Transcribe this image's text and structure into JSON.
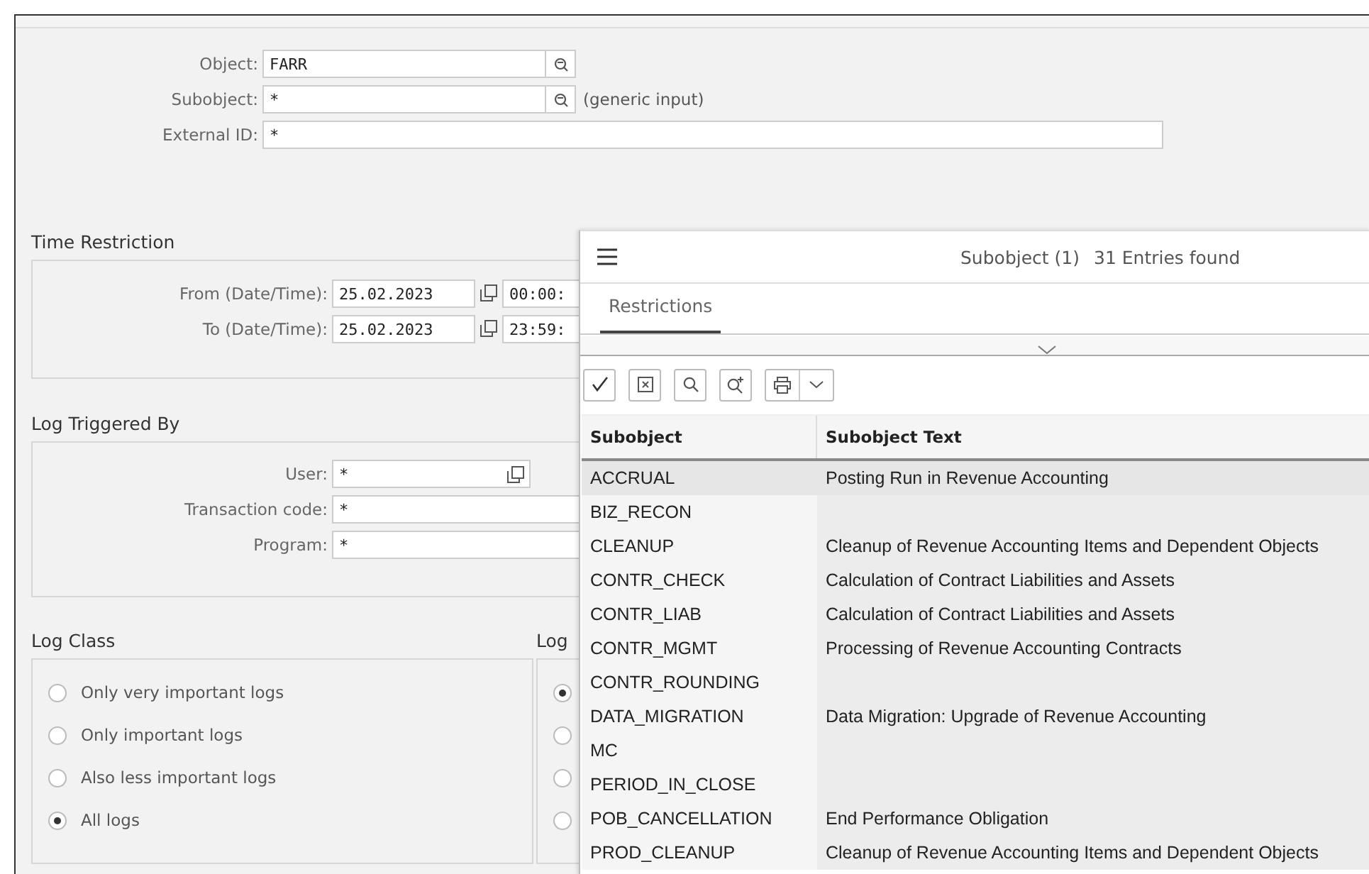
{
  "selection": {
    "fields": [
      {
        "label": "Object:",
        "value": "FARR",
        "has_search": true
      },
      {
        "label": "Subobject:",
        "value": "*",
        "has_search": true,
        "note": "(generic input)"
      },
      {
        "label": "External ID:",
        "value": "*",
        "has_search": false
      }
    ]
  },
  "time_restriction": {
    "title": "Time Restriction",
    "rows": [
      {
        "label": "From (Date/Time):",
        "date": "25.02.2023",
        "time": "00:00:"
      },
      {
        "label": "To (Date/Time):",
        "date": "25.02.2023",
        "time": "23:59:"
      }
    ]
  },
  "log_triggered_by": {
    "title": "Log Triggered By",
    "fields": [
      {
        "label": "User:",
        "value": "*",
        "kind": "short"
      },
      {
        "label": "Transaction code:",
        "value": "*",
        "kind": "long"
      },
      {
        "label": "Program:",
        "value": "*",
        "kind": "long"
      }
    ]
  },
  "log_class": {
    "title": "Log Class",
    "options": [
      {
        "label": "Only very important logs",
        "selected": false
      },
      {
        "label": "Only important logs",
        "selected": false
      },
      {
        "label": "Also less important logs",
        "selected": false
      },
      {
        "label": "All logs",
        "selected": true
      }
    ]
  },
  "group_2": {
    "title": "Log",
    "options": [
      {
        "selected": true
      },
      {
        "selected": false
      },
      {
        "selected": false
      },
      {
        "selected": false
      }
    ]
  },
  "popup": {
    "title": "Subobject (1)",
    "count": "31 Entries found",
    "tabs": [
      {
        "label": "Restrictions",
        "selected": true
      }
    ],
    "columns": [
      "Subobject",
      "Subobject Text"
    ],
    "rows": [
      {
        "code": "ACCRUAL",
        "text": "Posting Run in Revenue Accounting",
        "selected": true
      },
      {
        "code": "BIZ_RECON",
        "selected": false
      },
      {
        "code": "CLEANUP",
        "text": "Cleanup of Revenue Accounting Items and Dependent Objects",
        "selected": false
      },
      {
        "code": "CONTR_CHECK",
        "text": "Calculation of Contract Liabilities and Assets",
        "selected": false
      },
      {
        "code": "CONTR_LIAB",
        "text": "Calculation of Contract Liabilities and Assets",
        "selected": false
      },
      {
        "code": "CONTR_MGMT",
        "text": "Processing of Revenue Accounting Contracts",
        "selected": false
      },
      {
        "code": "CONTR_ROUNDING",
        "selected": false
      },
      {
        "code": "DATA_MIGRATION",
        "text": "Data Migration: Upgrade of Revenue Accounting",
        "selected": false
      },
      {
        "code": "MC",
        "selected": false
      },
      {
        "code": "PERIOD_IN_CLOSE",
        "selected": false
      },
      {
        "code": "POB_CANCELLATION",
        "text": "End Performance Obligation",
        "selected": false
      },
      {
        "code": "PROD_CLEANUP",
        "text": "Cleanup of Revenue Accounting Items and Dependent Objects",
        "selected": false
      }
    ]
  }
}
